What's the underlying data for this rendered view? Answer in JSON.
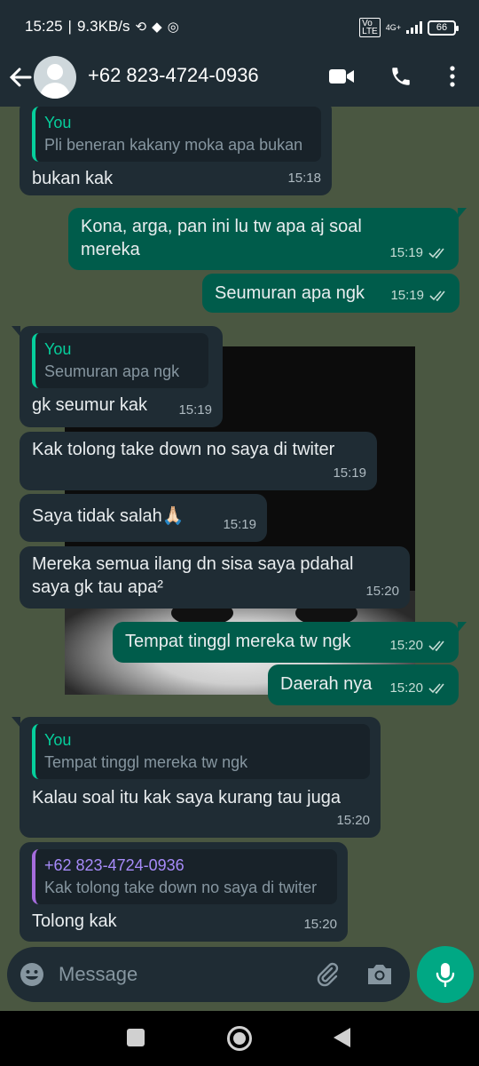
{
  "status": {
    "time": "15:25",
    "speed": "9.3KB/s",
    "net_top": "Vo",
    "net_bottom": "LTE",
    "gen": "4G+",
    "battery": "66"
  },
  "header": {
    "contact": "+62 823-4724-0936"
  },
  "messages": [
    {
      "quote_author": "You",
      "quote_text": "Pli beneran kakany moka apa bukan",
      "text": "bukan kak",
      "time": "15:18"
    },
    {
      "text": "Kona, arga, pan ini lu tw apa aj soal mereka",
      "time": "15:19"
    },
    {
      "text": "Seumuran apa ngk",
      "time": "15:19"
    },
    {
      "quote_author": "You",
      "quote_text": "Seumuran apa ngk",
      "text": "gk seumur kak",
      "time": "15:19"
    },
    {
      "text": "Kak tolong take down no saya di twiter",
      "time": "15:19"
    },
    {
      "text": "Saya tidak salah🙏🏻",
      "time": "15:19"
    },
    {
      "text": "Mereka semua ilang dn sisa saya pdahal saya gk tau apa²",
      "time": "15:20"
    },
    {
      "text": "Tempat tinggl mereka tw ngk",
      "time": "15:20"
    },
    {
      "text": "Daerah nya",
      "time": "15:20"
    },
    {
      "quote_author": "You",
      "quote_text": "Tempat tinggl mereka tw ngk",
      "text": "Kalau soal itu kak saya kurang tau juga",
      "time": "15:20"
    },
    {
      "quote_author": "+62 823-4724-0936",
      "quote_text": "Kak tolong take down no saya di twiter",
      "text": "Tolong kak",
      "time": "15:20"
    }
  ],
  "composer": {
    "placeholder": "Message"
  },
  "colors": {
    "incoming": "#1f2c34",
    "outgoing": "#005c4b",
    "accent": "#00a884",
    "wallpaper": "#4a5741"
  }
}
